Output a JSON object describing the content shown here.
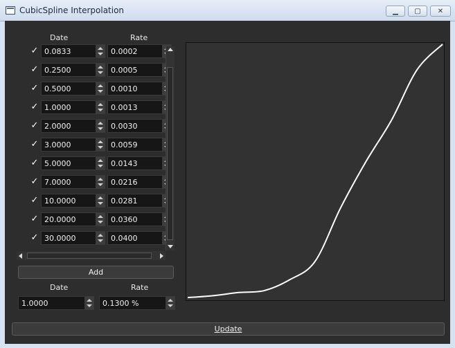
{
  "window": {
    "title": "CubicSpline Interpolation"
  },
  "table": {
    "headers": {
      "date": "Date",
      "rate": "Rate"
    },
    "rows": [
      {
        "checked": true,
        "date": "0.0833",
        "rate": "0.0002"
      },
      {
        "checked": true,
        "date": "0.2500",
        "rate": "0.0005"
      },
      {
        "checked": true,
        "date": "0.5000",
        "rate": "0.0010"
      },
      {
        "checked": true,
        "date": "1.0000",
        "rate": "0.0013"
      },
      {
        "checked": true,
        "date": "2.0000",
        "rate": "0.0030"
      },
      {
        "checked": true,
        "date": "3.0000",
        "rate": "0.0059"
      },
      {
        "checked": true,
        "date": "5.0000",
        "rate": "0.0143"
      },
      {
        "checked": true,
        "date": "7.0000",
        "rate": "0.0216"
      },
      {
        "checked": true,
        "date": "10.0000",
        "rate": "0.0281"
      },
      {
        "checked": true,
        "date": "20.0000",
        "rate": "0.0360"
      },
      {
        "checked": true,
        "date": "30.0000",
        "rate": "0.0400"
      }
    ]
  },
  "add_label": "Add",
  "query": {
    "date_label": "Date",
    "rate_label": "Rate",
    "date_value": "1.0000",
    "rate_value": "0.1300 %"
  },
  "update_label": "Update",
  "colors": {
    "curve": "#ffffff",
    "plot_bg": "#323232"
  }
}
